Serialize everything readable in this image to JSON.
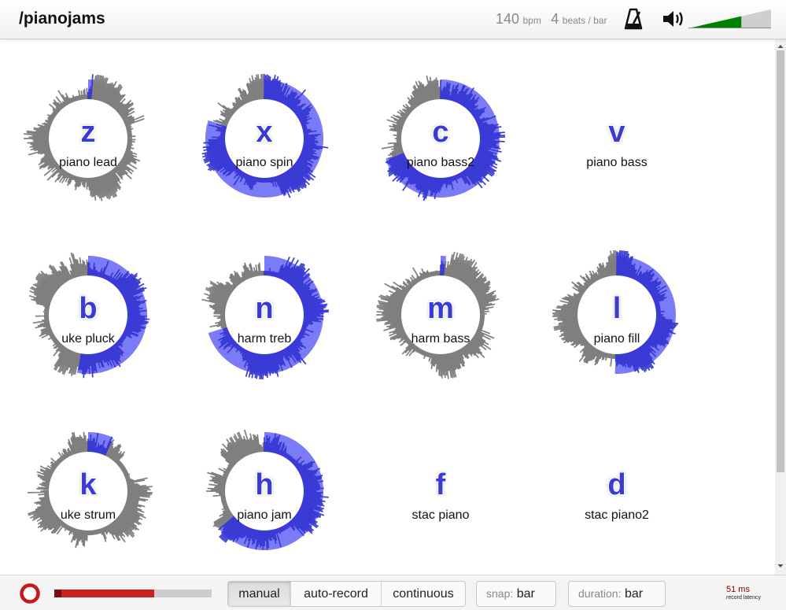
{
  "header": {
    "title": "/pianojams",
    "bpm_value": "140",
    "bpm_unit": "bpm",
    "beats_value": "4",
    "beats_unit": "beats / bar",
    "volume_level": 0.64
  },
  "pads": [
    {
      "key": "z",
      "label": "piano lead",
      "has_waveform": true,
      "progress": 0.015
    },
    {
      "key": "x",
      "label": "piano spin",
      "has_waveform": true,
      "progress": 0.8
    },
    {
      "key": "c",
      "label": "piano bass2",
      "has_waveform": true,
      "progress": 0.69
    },
    {
      "key": "v",
      "label": "piano bass",
      "has_waveform": false,
      "progress": 0
    },
    {
      "key": "b",
      "label": "uke pluck",
      "has_waveform": true,
      "progress": 0.53
    },
    {
      "key": "n",
      "label": "harm treb",
      "has_waveform": true,
      "progress": 0.7
    },
    {
      "key": "m",
      "label": "harm bass",
      "has_waveform": true,
      "progress": 0.015
    },
    {
      "key": "l",
      "label": "piano fill",
      "has_waveform": true,
      "progress": 0.505
    },
    {
      "key": "k",
      "label": "uke strum",
      "has_waveform": true,
      "progress": 0.07
    },
    {
      "key": "h",
      "label": "piano jam",
      "has_waveform": true,
      "progress": 0.64
    },
    {
      "key": "f",
      "label": "stac piano",
      "has_waveform": false,
      "progress": 0
    },
    {
      "key": "d",
      "label": "stac piano2",
      "has_waveform": false,
      "progress": 0
    }
  ],
  "footer": {
    "input_level": 0.62,
    "modes": [
      "manual",
      "auto-record",
      "continuous"
    ],
    "active_mode": "manual",
    "snap_label": "snap:",
    "snap_value": "bar",
    "duration_label": "duration:",
    "duration_value": "bar",
    "latency_value": "51 ms",
    "latency_label": "record latency"
  },
  "colors": {
    "accent": "#3a3ad4",
    "progress_light": "#7b7bf7",
    "waveform": "#7f7f7f",
    "volume": "#008000",
    "record": "#cc1f1f"
  },
  "icons": {
    "metronome": "metronome-icon",
    "speaker": "speaker-icon",
    "record": "record-icon"
  }
}
